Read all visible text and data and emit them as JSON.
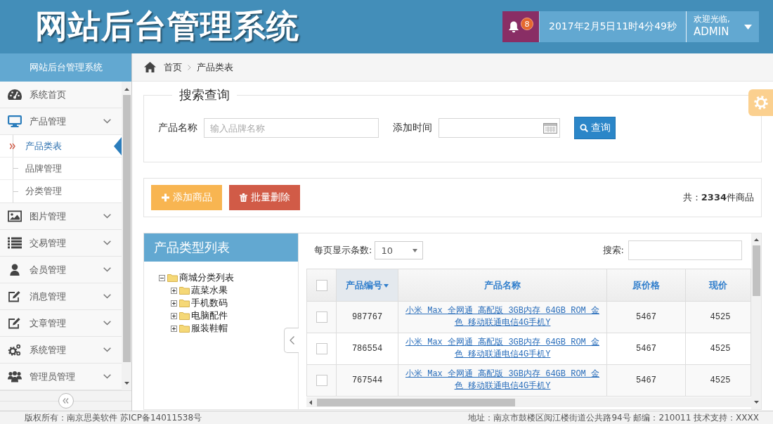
{
  "header": {
    "title": "网站后台管理系统",
    "notifications": {
      "count": "8"
    },
    "datetime": "2017年2月5日11时4分49秒",
    "user": {
      "greeting": "欢迎光临,",
      "name": "ADMIN"
    }
  },
  "sidebar": {
    "title": "网站后台管理系统",
    "items": [
      {
        "label": "系统首页",
        "kind": "link"
      },
      {
        "label": "产品管理",
        "kind": "group",
        "expanded": true,
        "children": [
          {
            "label": "产品类表",
            "selected": true
          },
          {
            "label": "品牌管理",
            "selected": false
          },
          {
            "label": "分类管理",
            "selected": false
          }
        ]
      },
      {
        "label": "图片管理",
        "kind": "group",
        "expanded": false
      },
      {
        "label": "交易管理",
        "kind": "group",
        "expanded": false
      },
      {
        "label": "会员管理",
        "kind": "group",
        "expanded": false
      },
      {
        "label": "消息管理",
        "kind": "group",
        "expanded": false
      },
      {
        "label": "文章管理",
        "kind": "group",
        "expanded": false
      },
      {
        "label": "系统管理",
        "kind": "group",
        "expanded": false
      },
      {
        "label": "管理员管理",
        "kind": "group",
        "expanded": false
      }
    ]
  },
  "breadcrumb": [
    {
      "label": "首页"
    },
    {
      "label": "产品类表"
    }
  ],
  "search_panel": {
    "title": "搜索查询",
    "fields": [
      {
        "label": "产品名称",
        "kind": "text",
        "placeholder": "输入品牌名称"
      },
      {
        "label": "添加时间",
        "kind": "date"
      }
    ],
    "button": "查询"
  },
  "toolbar": {
    "buttons": [
      {
        "label": "添加商品",
        "kind": "add"
      },
      {
        "label": "批量删除",
        "kind": "delete"
      }
    ],
    "total": "共：**2334**件商品"
  },
  "category_panel": {
    "title": "产品类型列表",
    "tree": [
      {
        "label": "商城分类列表",
        "expanded": true,
        "children": [
          {
            "label": "蔬菜水果",
            "expanded": false
          },
          {
            "label": "手机数码",
            "expanded": false
          },
          {
            "label": "电脑配件",
            "expanded": false
          },
          {
            "label": "服装鞋帽",
            "expanded": false
          }
        ]
      }
    ]
  },
  "table": {
    "page_size": {
      "label": "每页显示条数:",
      "value": "10"
    },
    "search": {
      "label": "搜索:"
    },
    "columns": [
      {
        "kind": "checkbox",
        "checked": false
      },
      {
        "kind": "text",
        "label": "产品编号",
        "sorted": true
      },
      {
        "kind": "text",
        "label": "产品名称",
        "sorted": false
      },
      {
        "kind": "text",
        "label": "原价格",
        "sorted": false
      },
      {
        "kind": "text",
        "label": "现价",
        "sorted": false
      }
    ],
    "rows": [
      {
        "checked": false,
        "id": "987767",
        "name": "小米 Max 全网通 高配版 3GB内存 64GB ROM 金色 移动联通电信4G手机Y",
        "original_price": "5467",
        "price": "4525"
      },
      {
        "checked": false,
        "id": "786554",
        "name": "小米 Max 全网通 高配版 3GB内存 64GB ROM 金色 移动联通电信4G手机Y",
        "original_price": "5467",
        "price": "4525"
      },
      {
        "checked": false,
        "id": "767544",
        "name": "小米 Max 全网通 高配版 3GB内存 64GB ROM 金色 移动联通电信4G手机Y",
        "original_price": "5467",
        "price": "4525"
      }
    ]
  },
  "footer": {
    "copyright": "版权所有：南京思美软件 苏ICP备14011538号",
    "address": "地址：南京市鼓楼区阅江楼街道公共路94号 邮编：210011 技术支持：XXXX"
  }
}
